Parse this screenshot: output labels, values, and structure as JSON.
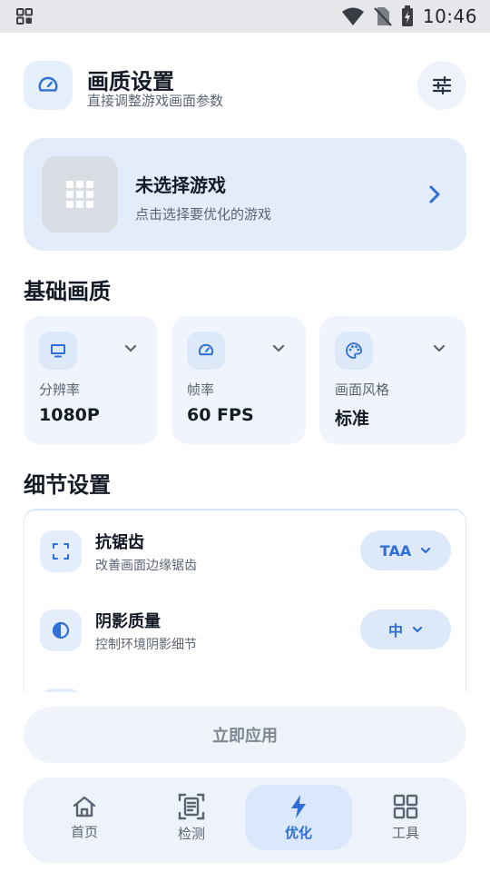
{
  "status_bar": {
    "time": "10:46"
  },
  "header": {
    "title": "画质设置",
    "subtitle": "直接调整游戏画面参数"
  },
  "game_card": {
    "title": "未选择游戏",
    "subtitle": "点击选择要优化的游戏"
  },
  "sections": {
    "basic": "基础画质",
    "detail": "细节设置"
  },
  "basic_cards": [
    {
      "label": "分辨率",
      "value": "1080P",
      "icon": "monitor-icon"
    },
    {
      "label": "帧率",
      "value": "60 FPS",
      "icon": "speedometer-icon"
    },
    {
      "label": "画面风格",
      "value": "标准",
      "icon": "palette-icon"
    }
  ],
  "detail_items": [
    {
      "title": "抗锯齿",
      "subtitle": "改善画面边缘锯齿",
      "value": "TAA",
      "icon": "fullscreen-icon"
    },
    {
      "title": "阴影质量",
      "subtitle": "控制环境阴影细节",
      "value": "中",
      "icon": "contrast-icon"
    }
  ],
  "apply_button": "立即应用",
  "nav": [
    {
      "label": "首页",
      "icon": "home-icon",
      "active": false
    },
    {
      "label": "检测",
      "icon": "scan-icon",
      "active": false
    },
    {
      "label": "优化",
      "icon": "bolt-icon",
      "active": true
    },
    {
      "label": "工具",
      "icon": "grid-icon",
      "active": false
    }
  ],
  "colors": {
    "accent": "#2f6fd6",
    "card_bg": "#e2ecfb",
    "text_primary": "#141a26",
    "text_secondary": "#5c6473"
  }
}
